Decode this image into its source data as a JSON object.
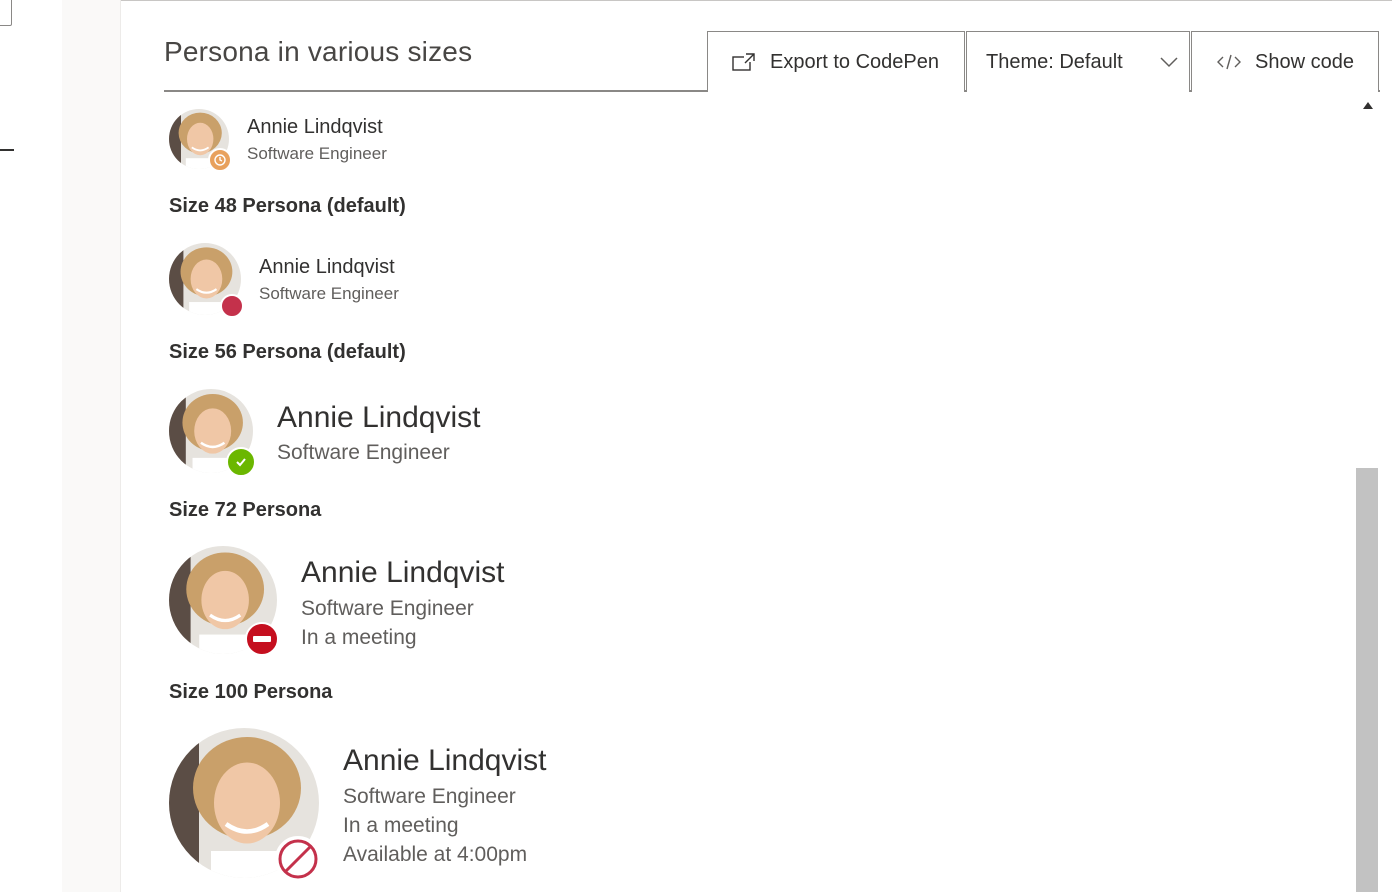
{
  "header": {
    "title": "Persona in various sizes",
    "export_label": "Export to CodePen",
    "theme_label": "Theme: Default",
    "show_code_label": "Show code"
  },
  "personas": [
    {
      "name": "Annie Lindqvist",
      "secondary": "Software Engineer",
      "presence": "away"
    },
    {
      "label": "Size 48 Persona (default)",
      "name": "Annie Lindqvist",
      "secondary": "Software Engineer",
      "presence": "busy"
    },
    {
      "label": "Size 56 Persona (default)",
      "name": "Annie Lindqvist",
      "secondary": "Software Engineer",
      "presence": "online"
    },
    {
      "label": "Size 72 Persona",
      "name": "Annie Lindqvist",
      "secondary": "Software Engineer",
      "tertiary": "In a meeting",
      "presence": "do-not-disturb"
    },
    {
      "label": "Size 100 Persona",
      "name": "Annie Lindqvist",
      "secondary": "Software Engineer",
      "tertiary": "In a meeting",
      "optional": "Available at 4:00pm",
      "presence": "blocked"
    }
  ],
  "colors": {
    "away": "#e8a15d",
    "busy": "#c4314b",
    "online": "#6bb700",
    "dnd": "#c50f1f",
    "blocked": "#c4314b"
  }
}
